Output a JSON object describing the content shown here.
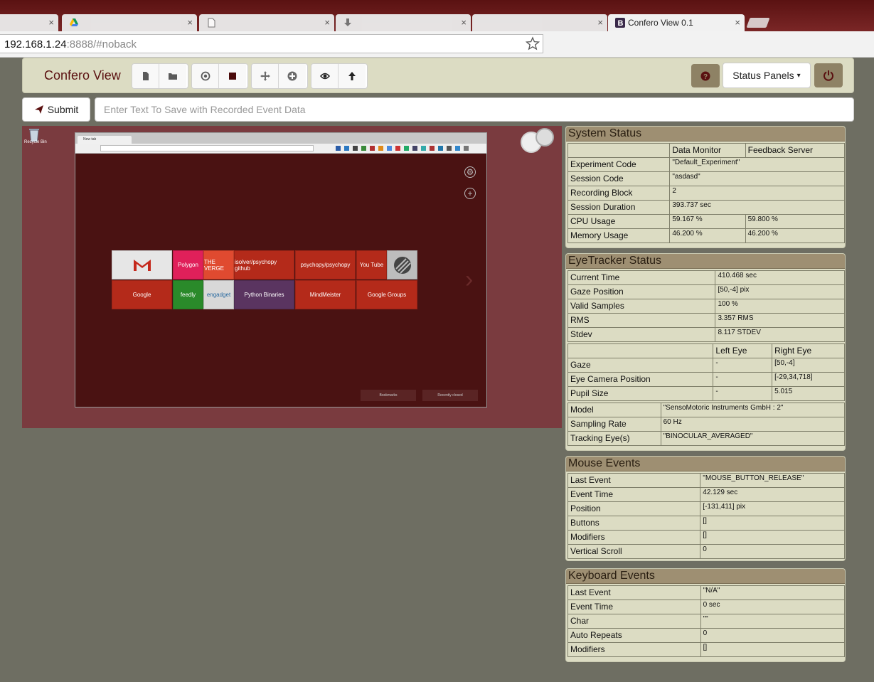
{
  "browser": {
    "tabs": [
      {
        "title": "",
        "icon": "blank",
        "close": "×"
      },
      {
        "title": "",
        "icon": "google-drive-icon",
        "close": "×"
      },
      {
        "title": "",
        "icon": "document-icon",
        "close": "×"
      },
      {
        "title": "",
        "icon": "download-icon",
        "close": "×"
      },
      {
        "title": "",
        "icon": "blank",
        "close": "×"
      },
      {
        "title": "Confero View 0.1",
        "icon": "bootstrap-b-icon",
        "close": "×"
      }
    ],
    "url_host": "192.168.1.24",
    "url_rest": ":8888/#noback"
  },
  "navbar": {
    "brand": "Confero View",
    "status_panels_label": "Status Panels",
    "caret": "▾"
  },
  "submit": {
    "label": "Submit",
    "placeholder": "Enter Text To Save with Recorded Event Data"
  },
  "screen_preview": {
    "recycle_label": "Recycle Bin",
    "mini_tab_title": "New tab",
    "tiles_row1": [
      "",
      "Polygon",
      "THE VERGE",
      "isolver/psychopy github",
      "psychopy/psychopy",
      "You Tube",
      ""
    ],
    "tiles_row2": [
      "Google",
      "feedly",
      "engadget",
      "Python Binaries",
      "MindMeister",
      "Google Groups"
    ],
    "bookmarks_label": "Bookmarks",
    "recently_closed_label": "Recently closed"
  },
  "system_status": {
    "title": "System Status",
    "col_headers": [
      "Data Monitor",
      "Feedback Server"
    ],
    "rows": [
      {
        "label": "Experiment Code",
        "v1": "\"Default_Experiment\"",
        "v2": null
      },
      {
        "label": "Session Code",
        "v1": "\"asdasd\"",
        "v2": null
      },
      {
        "label": "Recording Block",
        "v1": "2",
        "v2": null
      },
      {
        "label": "Session Duration",
        "v1": "393.737 sec",
        "v2": null
      },
      {
        "label": "CPU Usage",
        "v1": "59.167 %",
        "v2": "59.800 %"
      },
      {
        "label": "Memory Usage",
        "v1": "46.200 %",
        "v2": "46.200 %"
      }
    ]
  },
  "eyetracker_status": {
    "title": "EyeTracker Status",
    "rows": [
      {
        "label": "Current Time",
        "value": "410.468 sec"
      },
      {
        "label": "Gaze Position",
        "value": "[50,-4] pix"
      },
      {
        "label": "Valid Samples",
        "value": "100 %"
      },
      {
        "label": "RMS",
        "value": "3.357 RMS"
      },
      {
        "label": "Stdev",
        "value": "8.117 STDEV"
      }
    ],
    "eye_headers": [
      "Left Eye",
      "Right Eye"
    ],
    "eye_rows": [
      {
        "label": "Gaze",
        "left": "-",
        "right": "[50,-4]"
      },
      {
        "label": "Eye Camera Position",
        "left": "-",
        "right": "[-29,34,718]"
      },
      {
        "label": "Pupil Size",
        "left": "-",
        "right": "5.015"
      }
    ],
    "model_rows": [
      {
        "label": "Model",
        "value": "\"SensoMotoric Instruments GmbH : 2\""
      },
      {
        "label": "Sampling Rate",
        "value": "60 Hz"
      },
      {
        "label": "Tracking Eye(s)",
        "value": "\"BINOCULAR_AVERAGED\""
      }
    ]
  },
  "mouse_events": {
    "title": "Mouse Events",
    "rows": [
      {
        "label": "Last Event",
        "value": "\"MOUSE_BUTTON_RELEASE\""
      },
      {
        "label": "Event Time",
        "value": "42.129 sec"
      },
      {
        "label": "Position",
        "value": "[-131,411] pix"
      },
      {
        "label": "Buttons",
        "value": "[]"
      },
      {
        "label": "Modifiers",
        "value": "[]"
      },
      {
        "label": "Vertical Scroll",
        "value": "0"
      }
    ]
  },
  "keyboard_events": {
    "title": "Keyboard Events",
    "rows": [
      {
        "label": "Last Event",
        "value": "\"N/A\""
      },
      {
        "label": "Event Time",
        "value": "0 sec"
      },
      {
        "label": "Char",
        "value": "\"\""
      },
      {
        "label": "Auto Repeats",
        "value": "0"
      },
      {
        "label": "Modifiers",
        "value": "[]"
      }
    ]
  },
  "colors": {
    "accent": "#5a1010",
    "panel_bg": "#dcdcc3",
    "panel_header": "#9e8f72",
    "page_bg": "#6e6e62"
  }
}
